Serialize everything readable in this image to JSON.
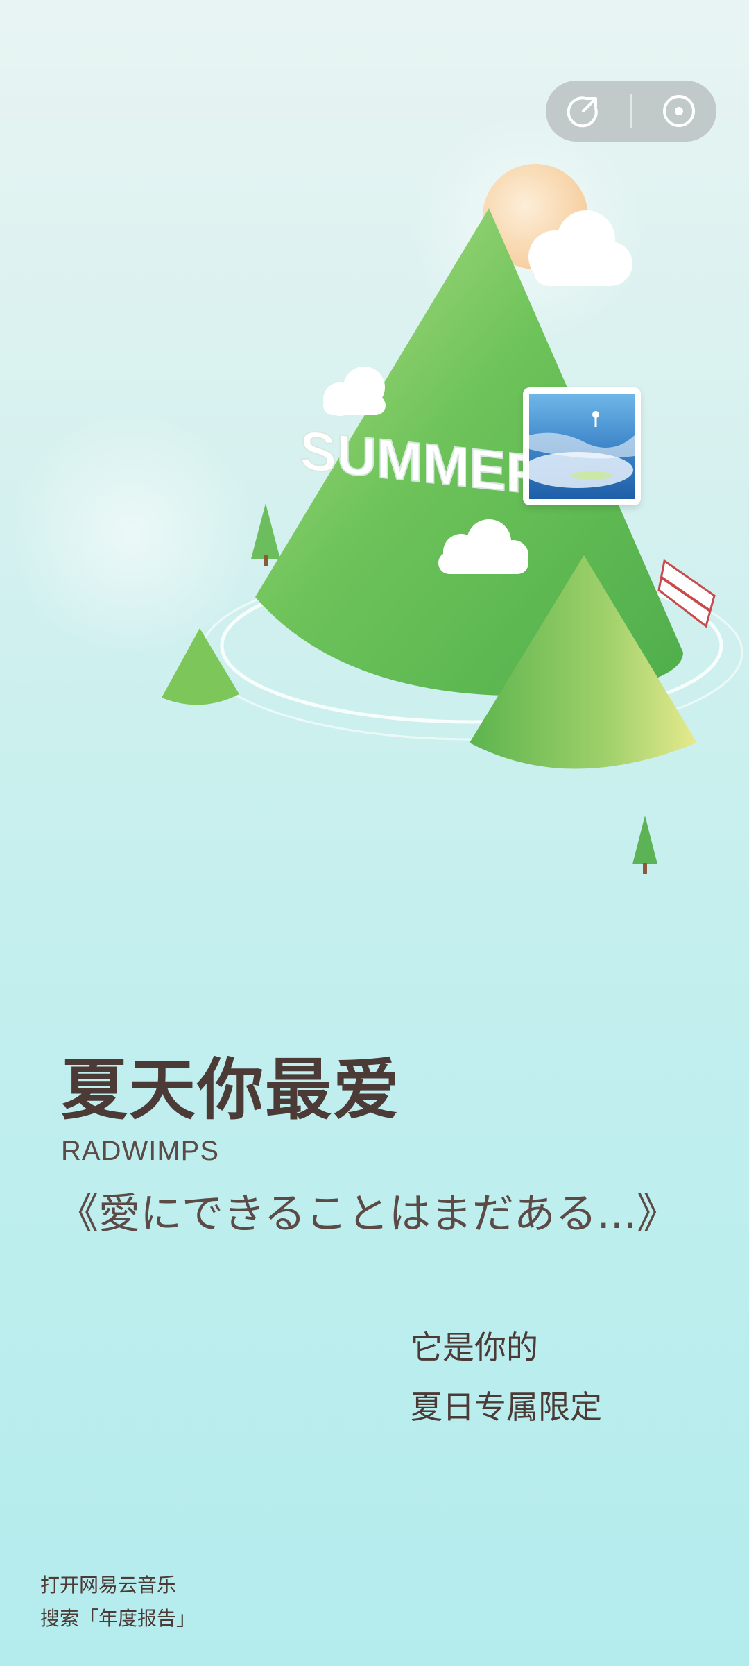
{
  "header": {
    "share_icon": "share-icon",
    "music_icon": "record-icon"
  },
  "scene": {
    "word": "SUMMER",
    "colors": {
      "mountain": "#6ec35a",
      "mountain_light": "#c9e58a",
      "sun": "#f9d9b0",
      "background_top": "#e8f4f3",
      "background_bottom": "#b4eced"
    }
  },
  "card": {
    "title": "夏天你最爱",
    "artist": "RADWIMPS",
    "song": "《愛にできることはまだある...》",
    "tagline_line1": "它是你的",
    "tagline_line2": "夏日专属限定"
  },
  "footer": {
    "line1": "打开网易云音乐",
    "line2": "搜索「年度报告」"
  }
}
